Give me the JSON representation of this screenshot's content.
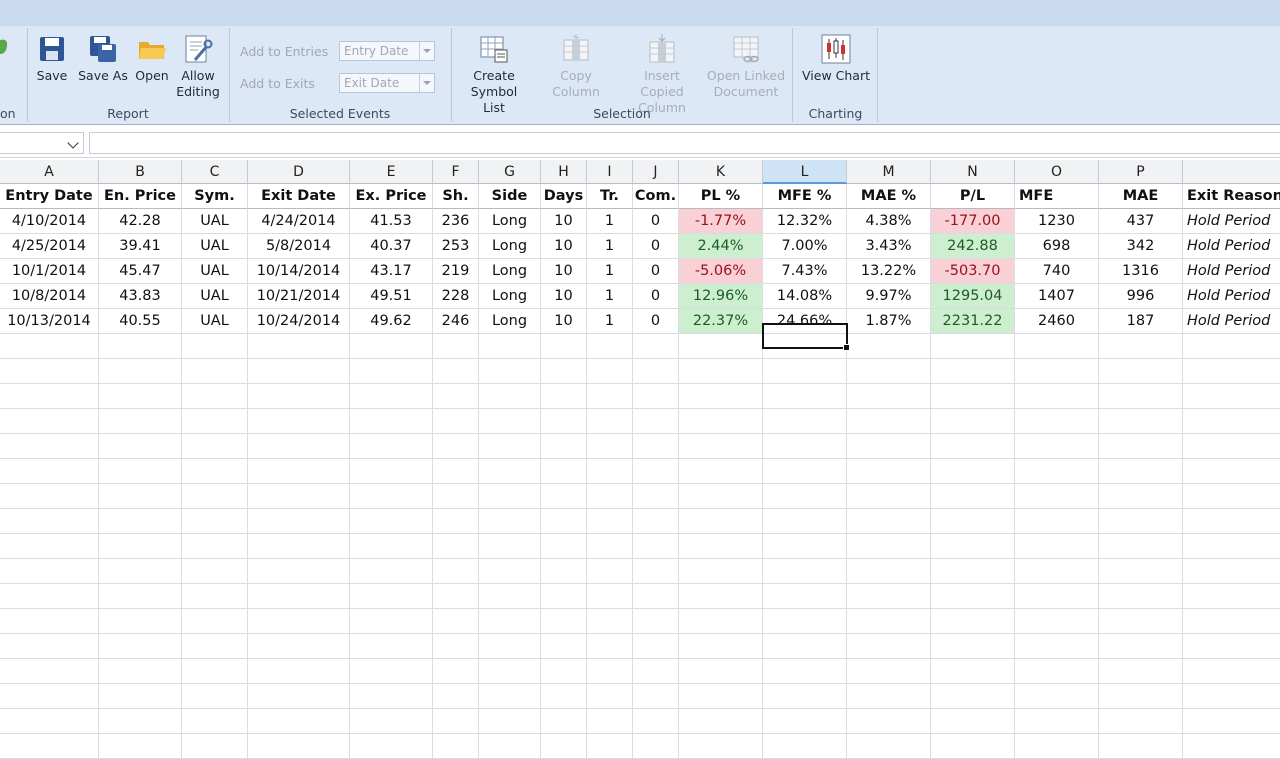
{
  "ribbon": {
    "report": {
      "label": "Report",
      "save": "Save",
      "save_as": "Save As",
      "open": "Open",
      "allow_editing_1": "Allow",
      "allow_editing_2": "Editing"
    },
    "partial_left_label": "on",
    "selected_events": {
      "label": "Selected Events",
      "add_entries": "Add to Entries",
      "add_exits": "Add to Exits",
      "entry_date_placeholder": "Entry Date",
      "exit_date_placeholder": "Exit Date"
    },
    "selection": {
      "label": "Selection",
      "create_symbol_list_1": "Create",
      "create_symbol_list_2": "Symbol List",
      "copy_column": "Copy Column",
      "insert_copied_1": "Insert Copied",
      "insert_copied_2": "Column",
      "open_linked_1": "Open Linked",
      "open_linked_2": "Document"
    },
    "charting": {
      "label": "Charting",
      "view_chart": "View Chart"
    }
  },
  "columns": [
    "A",
    "B",
    "C",
    "D",
    "E",
    "F",
    "G",
    "H",
    "I",
    "J",
    "K",
    "L",
    "M",
    "N",
    "O",
    "P",
    ""
  ],
  "selected_column": "L",
  "headers": [
    "Entry Date",
    "En. Price",
    "Sym.",
    "Exit Date",
    "Ex. Price",
    "Sh.",
    "Side",
    "Days",
    "Tr.",
    "Com.",
    "PL %",
    "MFE %",
    "MAE %",
    "P/L",
    "MFE",
    "MAE",
    "Exit Reason"
  ],
  "rows": [
    [
      "4/10/2014",
      "42.28",
      "UAL",
      "4/24/2014",
      "41.53",
      "236",
      "Long",
      "10",
      "1",
      "0",
      "-1.77%",
      "12.32%",
      "4.38%",
      "-177.00",
      "1230",
      "437",
      "Hold Period"
    ],
    [
      "4/25/2014",
      "39.41",
      "UAL",
      "5/8/2014",
      "40.37",
      "253",
      "Long",
      "10",
      "1",
      "0",
      "2.44%",
      "7.00%",
      "3.43%",
      "242.88",
      "698",
      "342",
      "Hold Period"
    ],
    [
      "10/1/2014",
      "45.47",
      "UAL",
      "10/14/2014",
      "43.17",
      "219",
      "Long",
      "10",
      "1",
      "0",
      "-5.06%",
      "7.43%",
      "13.22%",
      "-503.70",
      "740",
      "1316",
      "Hold Period"
    ],
    [
      "10/8/2014",
      "43.83",
      "UAL",
      "10/21/2014",
      "49.51",
      "228",
      "Long",
      "10",
      "1",
      "0",
      "12.96%",
      "14.08%",
      "9.97%",
      "1295.04",
      "1407",
      "996",
      "Hold Period"
    ],
    [
      "10/13/2014",
      "40.55",
      "UAL",
      "10/24/2014",
      "49.62",
      "246",
      "Long",
      "10",
      "1",
      "0",
      "22.37%",
      "24.66%",
      "1.87%",
      "2231.22",
      "2460",
      "187",
      "Hold Period"
    ]
  ],
  "colors": {
    "negative_fill": "#f9d0d6",
    "positive_fill": "#cdeecf",
    "selected_header": "#cfe3f7"
  }
}
